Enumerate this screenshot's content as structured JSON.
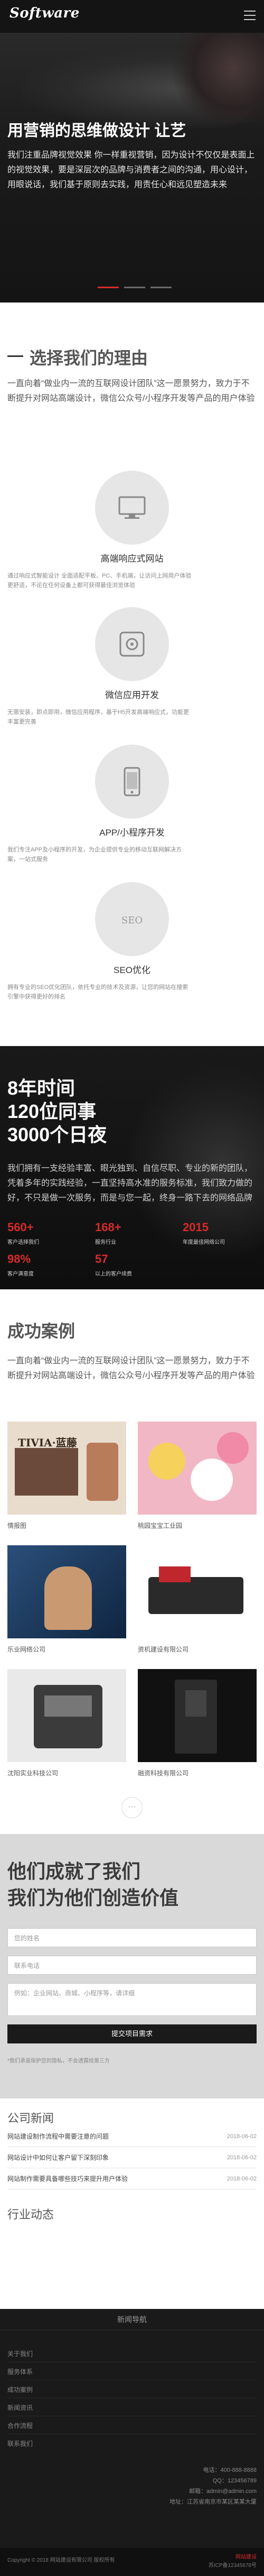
{
  "header": {
    "logo": "Software"
  },
  "hero": {
    "title": "用营销的思维做设计 让艺",
    "desc": "我们注重品牌视觉效果 你一样重视营销，因为设计不仅仅是表面上的视觉效果，要是深层次的品牌与消费者之间的沟通，用心设计，用眼说话，我们基于原则去实践，用责任心和远见塑造未来",
    "dots": 3
  },
  "why": {
    "title": "选择我们的理由",
    "intro": "一直向着“做业内一流的互联网设计团队”这一愿景努力，致力于不断提升对网站高端设计，微信公众号/小程序开发等产品的用户体验",
    "features": [
      {
        "name": "高端响应式网站",
        "desc": "通过响应式智能设计 全面适配平板、PC、手机端，让访问上网用户体验更舒适，不论在任何设备上都可获得最佳浏览体验"
      },
      {
        "name": "微信应用开发",
        "desc": "无需安装，即点即用，微信应用程序，基于H5开发高端响应式，功能更丰富更完善"
      },
      {
        "name": "APP/小程序开发",
        "desc": "我们专注APP及小程序的开发，为企业提供专业的移动互联网解决方案，一站式服务"
      },
      {
        "name": "SEO优化",
        "desc": "拥有专业的SEO优化团队，依托专业的技术及资源，让您的网站在搜索引擎中获得更好的排名"
      }
    ]
  },
  "stats": {
    "line1": "8年时间",
    "line2": "120位同事",
    "line3": "3000个日夜",
    "desc": "我们拥有一支经验丰富、眼光独到、自信尽职、专业的新的团队，凭着多年的实践经验，一直坚持高水准的服务标准，我们致力做的好，不只是做一次服务，而是与您一起，终身一路下去的网络品牌",
    "items": [
      {
        "num": "560+",
        "label": "客户选择我们"
      },
      {
        "num": "168+",
        "label": "服务行业"
      },
      {
        "num": "2015",
        "label": "年度最佳网络公司"
      },
      {
        "num": "98%",
        "label": "客户满意度"
      },
      {
        "num": "57",
        "label": "以上的客户续费"
      }
    ]
  },
  "cases": {
    "title": "成功案例",
    "intro": "一直向着“做业内一流的互联网设计团队”这一愿景努力，致力于不断提升对网站高端设计，微信公众号/小程序开发等产品的用户体验",
    "items": [
      {
        "name": "情报图",
        "img_text": "TIVIA·蓝藤"
      },
      {
        "name": "桃园宝宝工业园",
        "img_text": ""
      },
      {
        "name": "乐业网络公司",
        "img_text": ""
      },
      {
        "name": "资机建设有限公司",
        "img_text": ""
      },
      {
        "name": "沈阳实业科技公司",
        "img_text": ""
      },
      {
        "name": "融资科技有限公司",
        "img_text": ""
      }
    ],
    "more": "···"
  },
  "form": {
    "title_line1": "他们成就了我们",
    "title_line2": "我们为他们创造价值",
    "placeholders": [
      "您的姓名",
      "联系电话",
      "例如：企业网站、商城、小程序等，请详细"
    ],
    "submit": "提交项目需求",
    "note": "*我们承诺保护您的隐私，不会透露给第三方"
  },
  "news": {
    "company_head": "公司新闻",
    "company_items": [
      {
        "title": "网站建设制作流程中需要注意的问题",
        "date": "2018-06-02"
      },
      {
        "title": "网站设计中如何让客户留下深刻印象",
        "date": "2018-06-02"
      },
      {
        "title": "网站制作需要具备哪些技巧来提升用户体验",
        "date": "2018-06-02"
      }
    ],
    "industry_head": "行业动态"
  },
  "footer": {
    "head": "新闻导航",
    "links": [
      "关于我们",
      "服务体系",
      "成功案例",
      "新闻资讯",
      "合作流程",
      "联系我们"
    ],
    "info": [
      "电话：400-888-8888",
      "QQ：123456789",
      "邮箱：admin@admin.com",
      "地址：江苏省南京市某区某某大厦"
    ],
    "copyright": "Copyright © 2018 网站建设有限公司 版权所有",
    "right1": "网站建设",
    "right2": "苏ICP备12345678号"
  }
}
